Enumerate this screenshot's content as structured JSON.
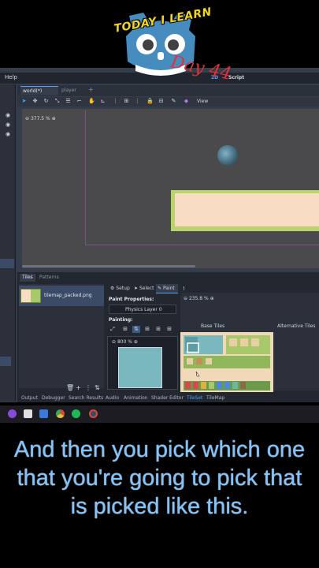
{
  "overlay": {
    "badge_top": "TODAY I LEARN",
    "badge_day": "Day 44"
  },
  "menubar": {
    "help": "Help",
    "mode_2d": "2D",
    "mode_script": "Script"
  },
  "scene_tabs": {
    "active": "world(*)",
    "second": "player",
    "add": "+"
  },
  "toolbar": {
    "view_label": "View"
  },
  "viewport": {
    "zoom": "377.5 %"
  },
  "bottom_panel": {
    "tabs": [
      "Tiles",
      "Patterns"
    ],
    "source_name": "tilemap_packed.png",
    "prop_tabs": {
      "setup": "Setup",
      "select": "Select",
      "paint": "Paint"
    },
    "paint_properties": "Paint Properties:",
    "physics_layer": "Physics Layer 0",
    "painting": "Painting:",
    "preview_zoom": "800 %",
    "atlas_zoom": "235.8 %",
    "base_tiles": "Base Tiles",
    "alternative_tiles": "Alternative Tiles"
  },
  "bottom_tabs": [
    "Output",
    "Debugger",
    "Search Results",
    "Audio",
    "Animation",
    "Shader Editor",
    "TileSet",
    "TileMap"
  ],
  "caption": "And then you pick which one that you're going to pick that is picked like this.",
  "colors": {
    "accent": "#4aa3ff",
    "caption": "#7fc3ff",
    "badge_yellow": "#f5d51e",
    "day_red": "#e0303a"
  }
}
